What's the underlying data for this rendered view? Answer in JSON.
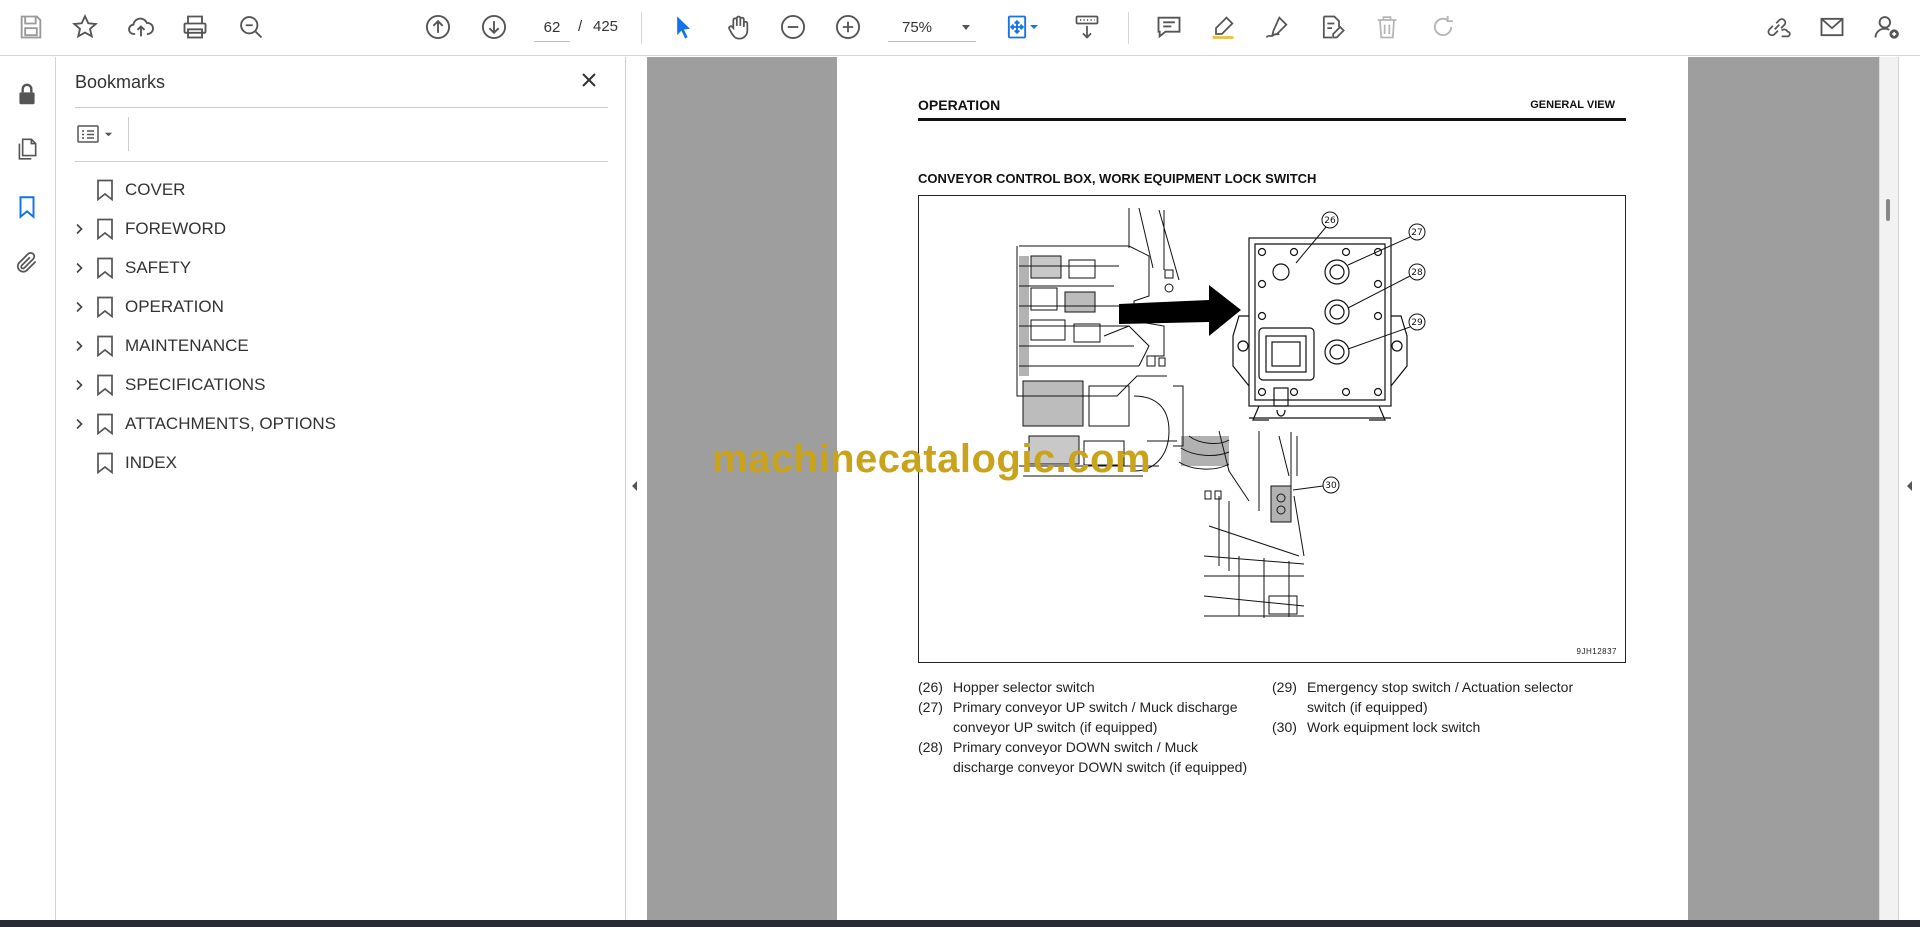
{
  "toolbar": {
    "page_current": "62",
    "page_separator": "/",
    "page_total": "425",
    "zoom": "75%"
  },
  "bookmarks_panel": {
    "title": "Bookmarks",
    "items": [
      {
        "label": "COVER",
        "expandable": false
      },
      {
        "label": "FOREWORD",
        "expandable": true
      },
      {
        "label": "SAFETY",
        "expandable": true
      },
      {
        "label": "OPERATION",
        "expandable": true
      },
      {
        "label": "MAINTENANCE",
        "expandable": true
      },
      {
        "label": "SPECIFICATIONS",
        "expandable": true
      },
      {
        "label": "ATTACHMENTS, OPTIONS",
        "expandable": true
      },
      {
        "label": "INDEX",
        "expandable": false
      }
    ]
  },
  "document": {
    "header_left": "OPERATION",
    "header_right": "GENERAL VIEW",
    "section_title": "CONVEYOR CONTROL BOX, WORK EQUIPMENT LOCK SWITCH",
    "figure_code": "9JH12837",
    "callouts": [
      "26",
      "27",
      "28",
      "29",
      "30"
    ],
    "legend_left": [
      {
        "num": "(26)",
        "text": "Hopper selector switch"
      },
      {
        "num": "(27)",
        "text": "Primary conveyor UP switch / Muck discharge",
        "text2": "conveyor UP switch (if equipped)"
      },
      {
        "num": "(28)",
        "text": "Primary conveyor DOWN switch / Muck",
        "text2": "discharge conveyor DOWN switch (if equipped)"
      }
    ],
    "legend_right": [
      {
        "num": "(29)",
        "text": "Emergency stop switch / Actuation selector",
        "text2": "switch (if equipped)"
      },
      {
        "num": "(30)",
        "text": "Work equipment lock switch"
      }
    ]
  },
  "watermark": "machinecatalogic.com",
  "colors": {
    "accent_blue": "#1473e6",
    "viewer_bg": "#9e9e9e",
    "watermark": "#c9a31a"
  }
}
